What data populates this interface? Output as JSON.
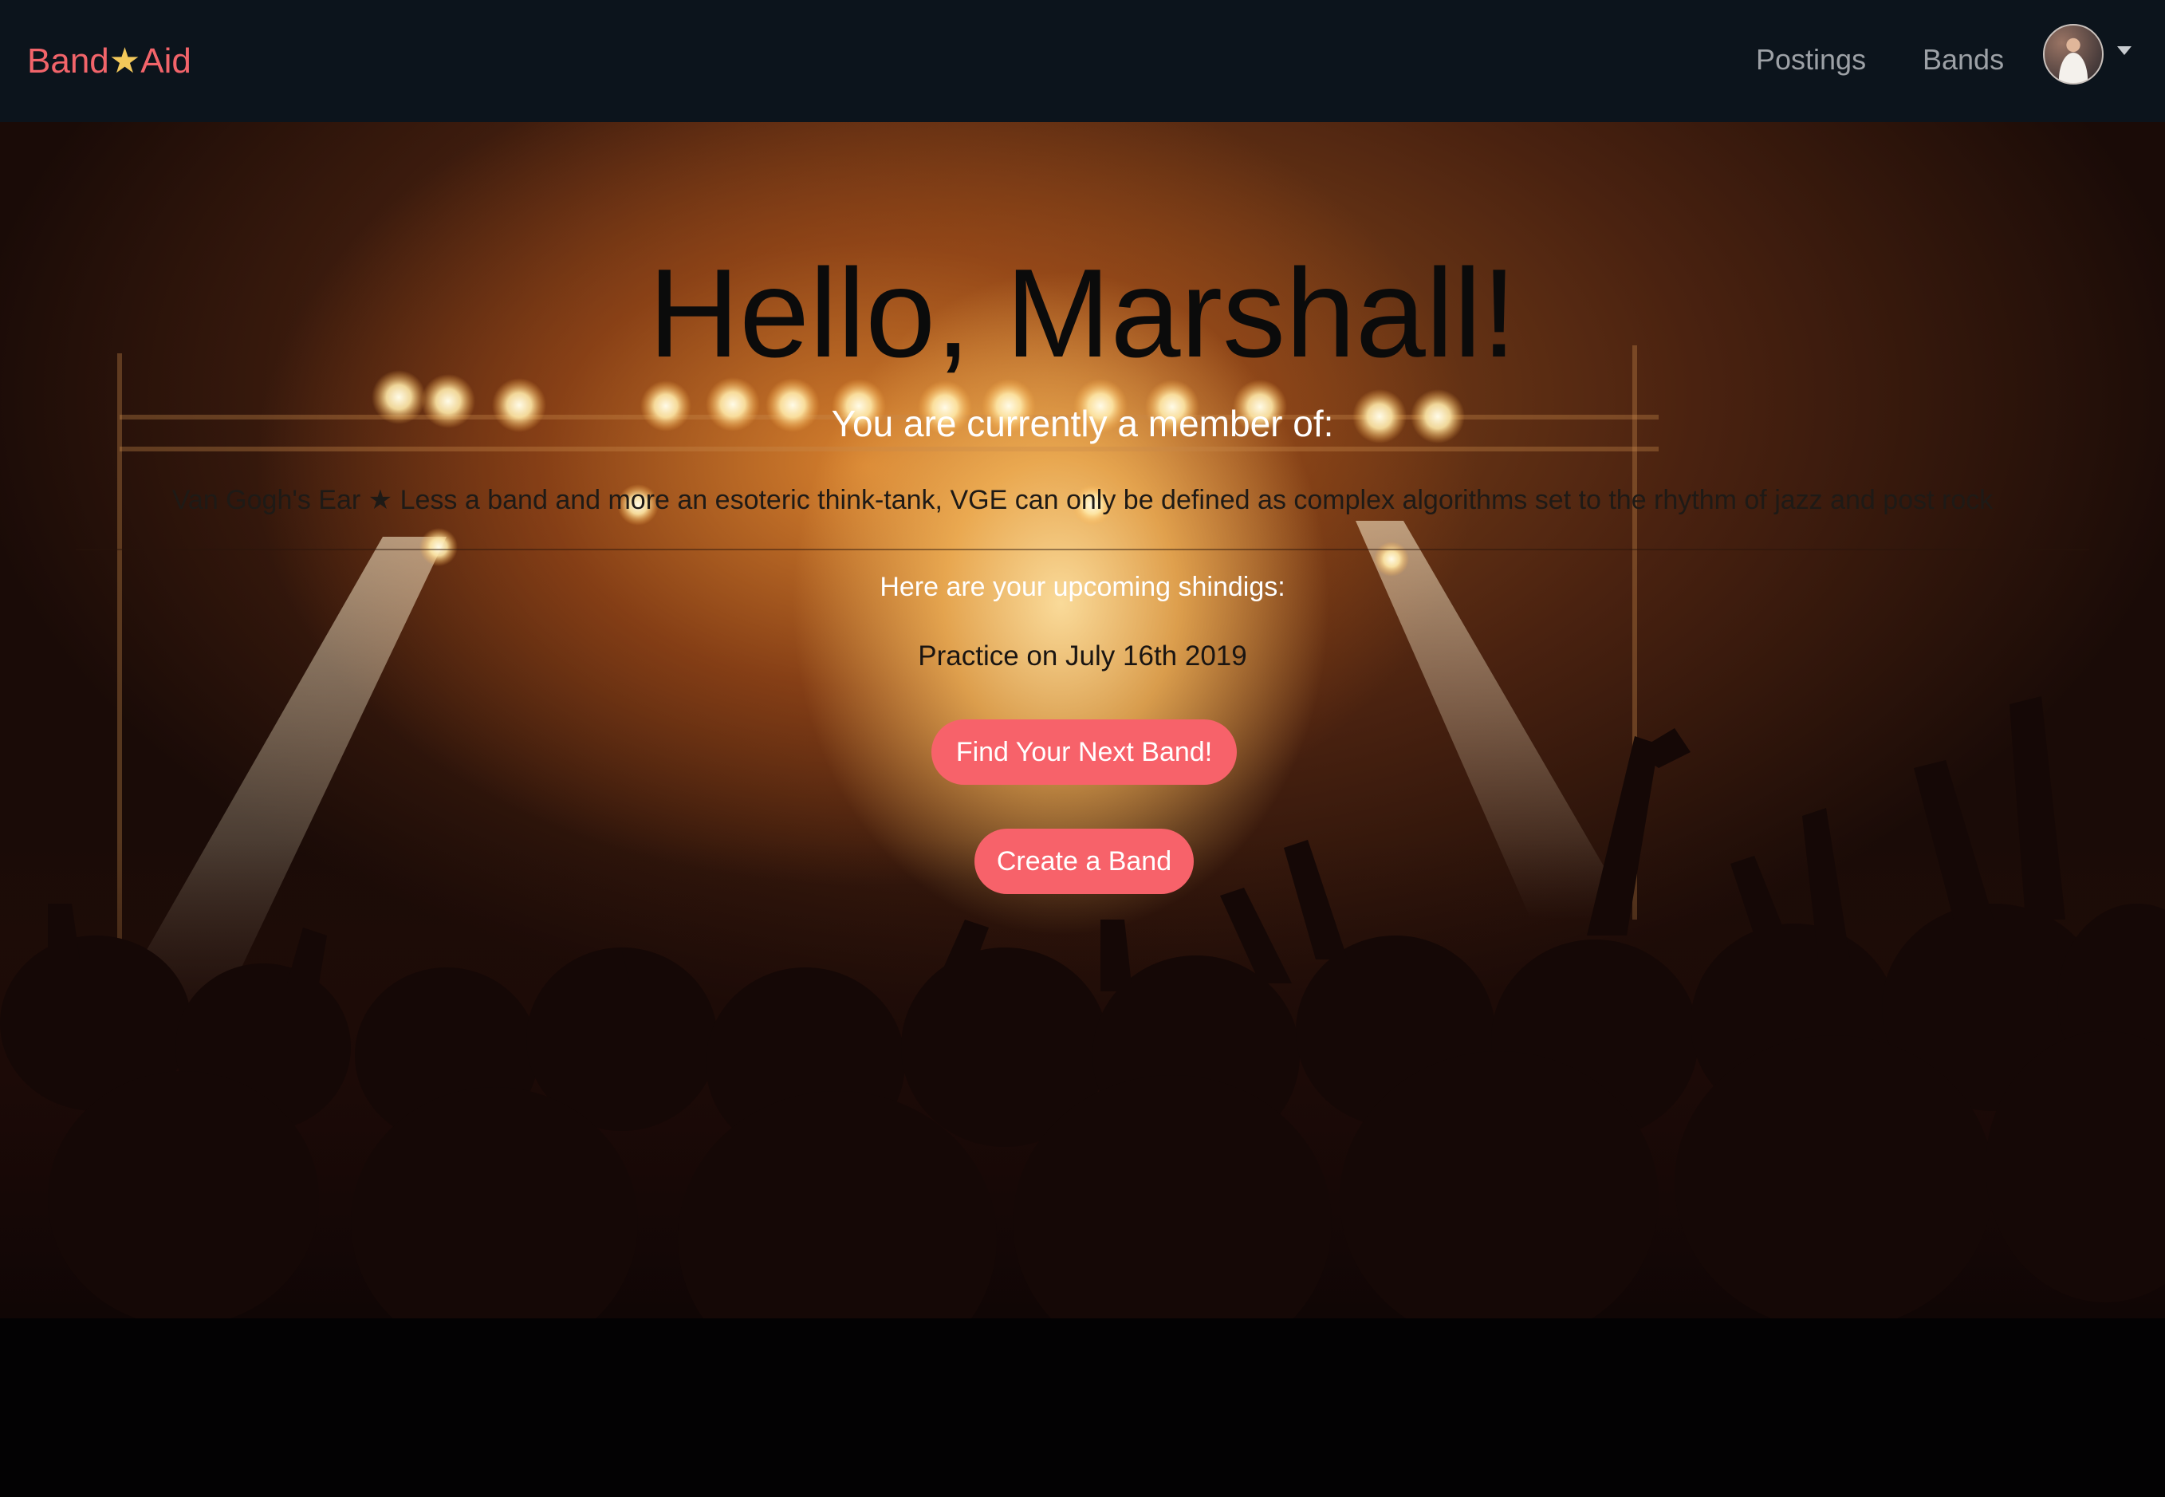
{
  "navbar": {
    "brand": {
      "part1": "Band",
      "star": "★",
      "part2": "Aid"
    },
    "links": [
      {
        "label": "Postings"
      },
      {
        "label": "Bands"
      }
    ],
    "user_menu": {
      "avatar_icon": "user-avatar-icon",
      "caret_icon": "caret-down-icon"
    }
  },
  "hero": {
    "greeting": "Hello, Marshall!",
    "member_heading": "You are currently a member of:",
    "bands": [
      {
        "name": "Van Gogh's Ear",
        "separator": "★",
        "description": "Less a band and more an esoteric think-tank, VGE can only be defined as complex algorithms set to the rhythm of jazz and post rock"
      }
    ],
    "shindigs_heading": "Here are your upcoming shindigs:",
    "events": [
      {
        "label": "Practice on July 16th 2019"
      }
    ],
    "buttons": {
      "find_band": "Find Your Next Band!",
      "create_band": "Create a Band"
    }
  },
  "colors": {
    "accent": "#f7626a",
    "brand_star": "#f3c85a",
    "navbar_bg": "#0c141c",
    "nav_link": "#9da1a6"
  }
}
